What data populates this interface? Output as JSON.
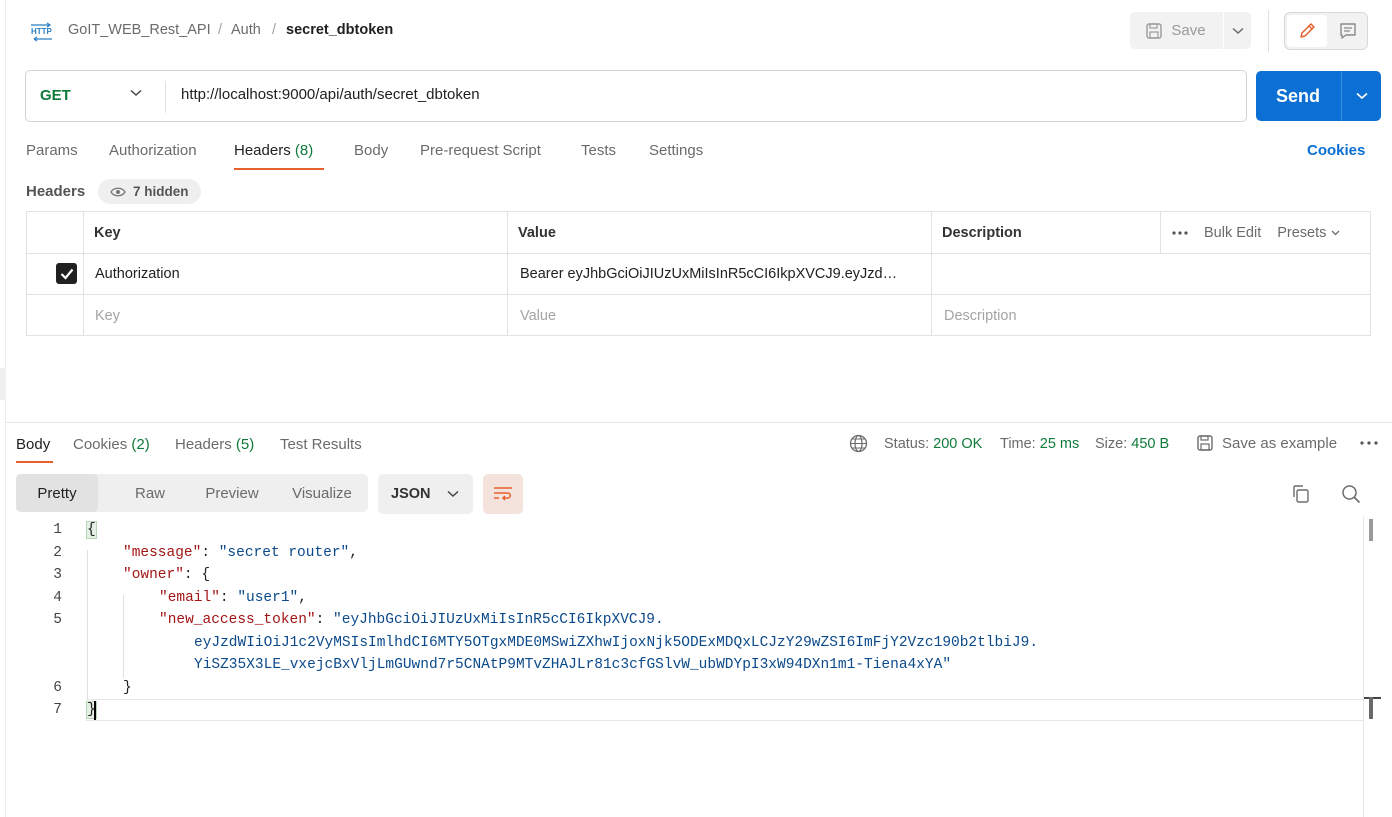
{
  "breadcrumb": {
    "items": [
      "GoIT_WEB_Rest_API",
      "Auth"
    ],
    "separator": "/",
    "current": "secret_dbtoken"
  },
  "toolbar": {
    "save_label": "Save"
  },
  "request": {
    "method": "GET",
    "url": "http://localhost:9000/api/auth/secret_dbtoken",
    "send_label": "Send"
  },
  "request_tabs": [
    {
      "label": "Params",
      "count": ""
    },
    {
      "label": "Authorization",
      "count": ""
    },
    {
      "label": "Headers",
      "count": "(8)"
    },
    {
      "label": "Body",
      "count": ""
    },
    {
      "label": "Pre-request Script",
      "count": ""
    },
    {
      "label": "Tests",
      "count": ""
    },
    {
      "label": "Settings",
      "count": ""
    }
  ],
  "cookies_link": "Cookies",
  "headers_section": {
    "title": "Headers",
    "hidden_label": "7 hidden",
    "columns": [
      "Key",
      "Value",
      "Description"
    ],
    "bulk_edit": "Bulk Edit",
    "presets": "Presets",
    "rows": [
      {
        "key": "Authorization",
        "value": "Bearer eyJhbGciOiJIUzUxMiIsInR5cCI6IkpXVCJ9.eyJzd…",
        "description": ""
      }
    ],
    "placeholder": {
      "key": "Key",
      "value": "Value",
      "description": "Description"
    }
  },
  "response_tabs": [
    {
      "label": "Body",
      "count": ""
    },
    {
      "label": "Cookies",
      "count": "(2)"
    },
    {
      "label": "Headers",
      "count": "(5)"
    },
    {
      "label": "Test Results",
      "count": ""
    }
  ],
  "response_meta": {
    "status_label": "Status:",
    "status_value": "200 OK",
    "time_label": "Time:",
    "time_value": "25 ms",
    "size_label": "Size:",
    "size_value": "450 B",
    "save_example": "Save as example"
  },
  "view_modes": [
    "Pretty",
    "Raw",
    "Preview",
    "Visualize"
  ],
  "format": "JSON",
  "code": {
    "line_numbers": [
      "1",
      "2",
      "3",
      "4",
      "5",
      "6",
      "7"
    ],
    "open_brace": "{",
    "close_brace": "}",
    "message_key": "\"message\"",
    "message_value": "\"secret router\"",
    "owner_key": "\"owner\"",
    "email_key": "\"email\"",
    "email_value": "\"user1\"",
    "token_key": "\"new_access_token\"",
    "token_part1": "\"eyJhbGciOiJIUzUxMiIsInR5cCI6IkpXVCJ9.",
    "token_part2": "eyJzdWIiOiJ1c2VyMSIsImlhdCI6MTY5OTgxMDE0MSwiZXhwIjoxNjk5ODExMDQxLCJzY29wZSI6ImFjY2Vzc190b2tlbiJ9.",
    "token_part3": "YiSZ35X3LE_vxejcBxVljLmGUwnd7r5CNAtP9MTvZHAJLr81c3cfGSlvW_ubWDYpI3xW94DXn1m1-Tiena4xYA\""
  },
  "colors": {
    "accent": "#e8612c",
    "primary": "#0b6fd3",
    "success": "#0f7a3a",
    "json_key": "#a31515",
    "json_string": "#0b4a8b"
  }
}
